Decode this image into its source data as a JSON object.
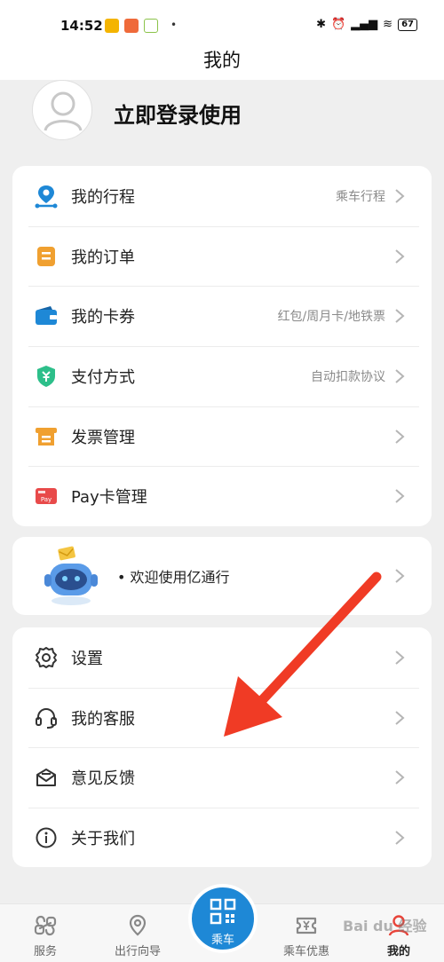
{
  "status_bar": {
    "time": "14:52",
    "battery": "67"
  },
  "header": {
    "title": "我的"
  },
  "profile": {
    "login_text": "立即登录使用"
  },
  "menu1": [
    {
      "label": "我的行程",
      "sub": "乘车行程",
      "icon": "route-pin-icon"
    },
    {
      "label": "我的订单",
      "sub": "",
      "icon": "order-clipboard-icon"
    },
    {
      "label": "我的卡券",
      "sub": "红包/周月卡/地铁票",
      "icon": "wallet-icon"
    },
    {
      "label": "支付方式",
      "sub": "自动扣款协议",
      "icon": "shield-yen-icon"
    },
    {
      "label": "发票管理",
      "sub": "",
      "icon": "invoice-icon"
    },
    {
      "label": "Pay卡管理",
      "sub": "",
      "icon": "pay-card-icon"
    }
  ],
  "promo": {
    "text": "• 欢迎使用亿通行"
  },
  "menu2": [
    {
      "label": "设置",
      "icon": "gear-icon"
    },
    {
      "label": "我的客服",
      "icon": "headset-icon"
    },
    {
      "label": "意见反馈",
      "icon": "feedback-mail-icon"
    },
    {
      "label": "关于我们",
      "icon": "info-icon"
    }
  ],
  "tabbar": {
    "services": "服务",
    "travel_guide": "出行向导",
    "ride": "乘车",
    "ride_offers": "乘车优惠",
    "mine": "我的"
  },
  "watermark": "Bai du 经验",
  "colors": {
    "accent_blue": "#1e88d6",
    "orange": "#f0a030",
    "green": "#2dbf8a",
    "red": "#e84a4a",
    "annotation_arrow": "#f03b25"
  }
}
